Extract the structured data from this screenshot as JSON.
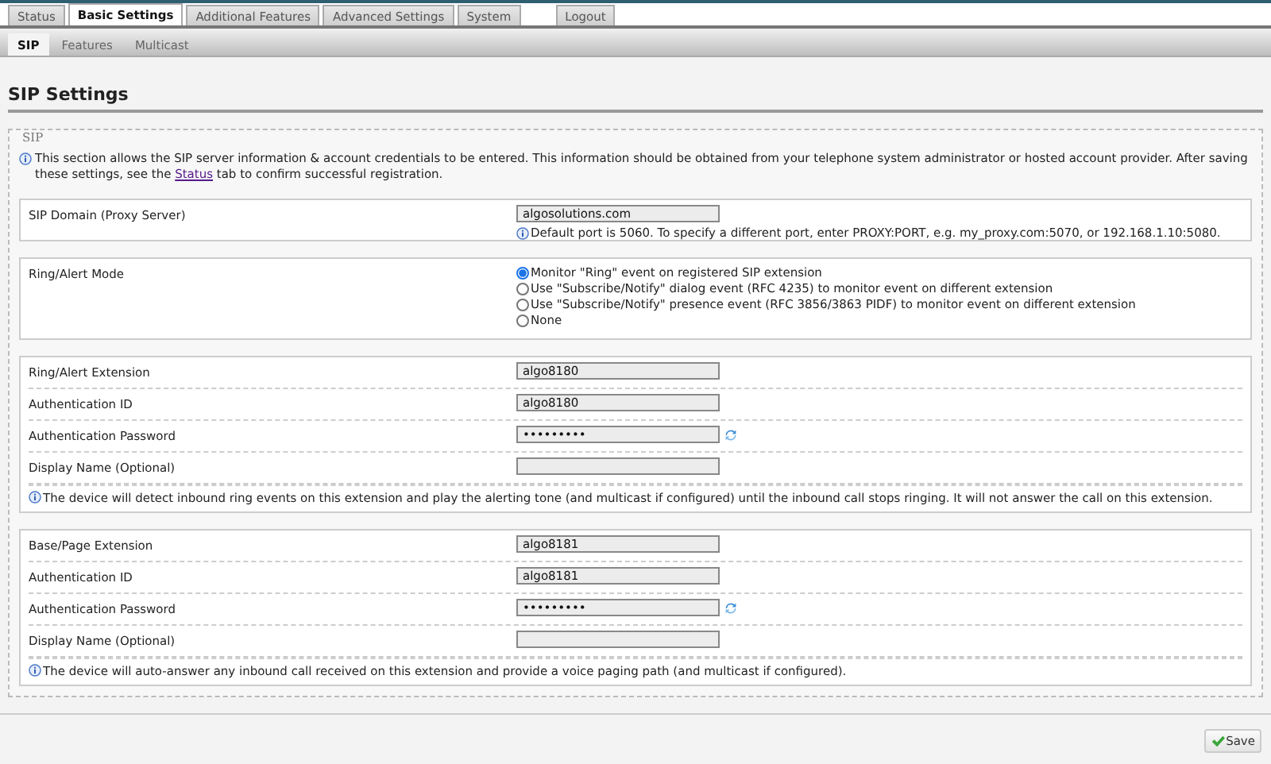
{
  "tabs": [
    {
      "label": "Status",
      "selected": false
    },
    {
      "label": "Basic Settings",
      "selected": true
    },
    {
      "label": "Additional Features",
      "selected": false
    },
    {
      "label": "Advanced Settings",
      "selected": false
    },
    {
      "label": "System",
      "selected": false
    }
  ],
  "logout": "Logout",
  "subtabs": [
    {
      "label": "SIP",
      "selected": true
    },
    {
      "label": "Features",
      "selected": false
    },
    {
      "label": "Multicast",
      "selected": false
    }
  ],
  "page_title": "SIP Settings",
  "section": {
    "legend": "SIP",
    "intro_before": "This section allows the SIP server information & account credentials to be entered. This information should be obtained from your telephone system administrator or hosted account provider. After saving these settings, see the ",
    "intro_link": "Status",
    "intro_after": " tab to confirm successful registration."
  },
  "groups": [
    {
      "kind": "fields",
      "rows": [
        {
          "label": "SIP Domain (Proxy Server)",
          "value": "algosolutions.com",
          "kind": "text",
          "hint": "Default port is 5060. To specify a different port, enter PROXY:PORT, e.g. my_proxy.com:5070, or 192.168.1.10:5080."
        }
      ]
    },
    {
      "kind": "radio",
      "label": "Ring/Alert Mode",
      "options": [
        {
          "label": "Monitor \"Ring\" event on registered SIP extension",
          "selected": true
        },
        {
          "label": "Use \"Subscribe/Notify\" dialog event (RFC 4235) to monitor event on different extension",
          "selected": false
        },
        {
          "label": "Use \"Subscribe/Notify\" presence event (RFC 3856/3863 PIDF) to monitor event on different extension",
          "selected": false
        },
        {
          "label": "None",
          "selected": false
        }
      ]
    },
    {
      "kind": "fields",
      "rows": [
        {
          "label": "Ring/Alert Extension",
          "value": "algo8180",
          "kind": "text"
        },
        {
          "label": "Authentication ID",
          "value": "algo8180",
          "kind": "text"
        },
        {
          "label": "Authentication Password",
          "value": "•••••••••",
          "kind": "password"
        },
        {
          "label": "Display Name (Optional)",
          "kind": "text"
        }
      ],
      "note": "The device will detect inbound ring events on this extension and play the alerting tone (and multicast if configured) until the inbound call stops ringing. It will not answer the call on this extension."
    },
    {
      "kind": "fields",
      "rows": [
        {
          "label": "Base/Page Extension",
          "value": "algo8181",
          "kind": "text"
        },
        {
          "label": "Authentication ID",
          "value": "algo8181",
          "kind": "text"
        },
        {
          "label": "Authentication Password",
          "value": "•••••••••",
          "kind": "password"
        },
        {
          "label": "Display Name (Optional)",
          "kind": "text"
        }
      ],
      "note": "The device will auto-answer any inbound call received on this extension and provide a voice paging path (and multicast if configured)."
    }
  ],
  "save": "Save"
}
